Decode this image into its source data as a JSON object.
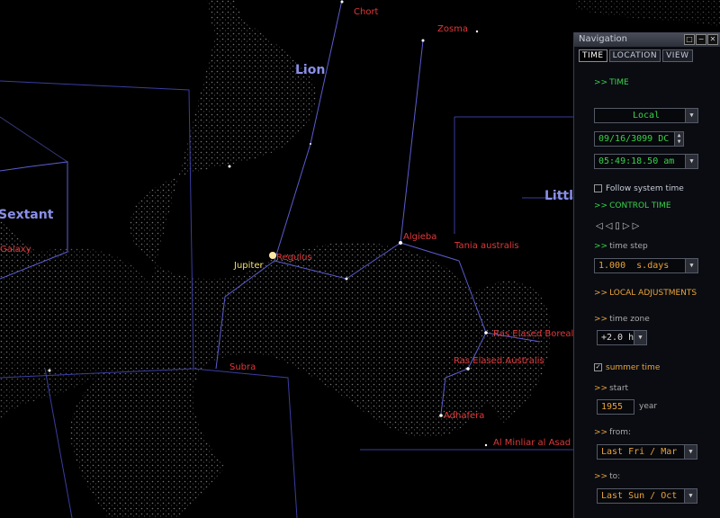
{
  "sky": {
    "constellations": [
      "Lion",
      "Sextant",
      "Littl"
    ],
    "stars": [
      "Chort",
      "Zosma",
      "Algieba",
      "Tania australis",
      "Ras Elased Borealis",
      "Ras Elased Australis",
      "Adhafera",
      "Al Minliar al Asad",
      "Subra",
      "Regulus",
      "Galaxy"
    ],
    "planets": [
      "Jupiter"
    ]
  },
  "nav": {
    "title": "Navigation",
    "window_buttons": [
      "□",
      "−",
      "✕"
    ],
    "tabs": [
      "TIME",
      "LOCATION",
      "VIEW"
    ],
    "time_section": "TIME",
    "time_mode": "Local",
    "date": "09/16/3099 DC",
    "clock": "05:49:18.50 am",
    "follow_system": "Follow system time",
    "control_time": "CONTROL TIME",
    "control_glyphs": "◁◁▯▷▷",
    "time_step_label": "time step",
    "time_step_value": "1.000",
    "time_step_unit": "s.days",
    "local_adjustments": "LOCAL ADJUSTMENTS",
    "time_zone_label": "time zone",
    "time_zone_value": "+2.0 h",
    "summer_time": "summer time",
    "start_label": "start",
    "start_year": "1955",
    "year_label": "year",
    "from_label": "from:",
    "from_value": "Last  Fri  / Mar",
    "to_label": "to:",
    "to_value": "Last  Sun  / Oct",
    "chevron": ">>"
  },
  "colors": {
    "accent_green": "#38d24a",
    "accent_orange": "#e8a33a",
    "label_red": "#e0383a",
    "constellation_blue": "#8a90e8"
  }
}
